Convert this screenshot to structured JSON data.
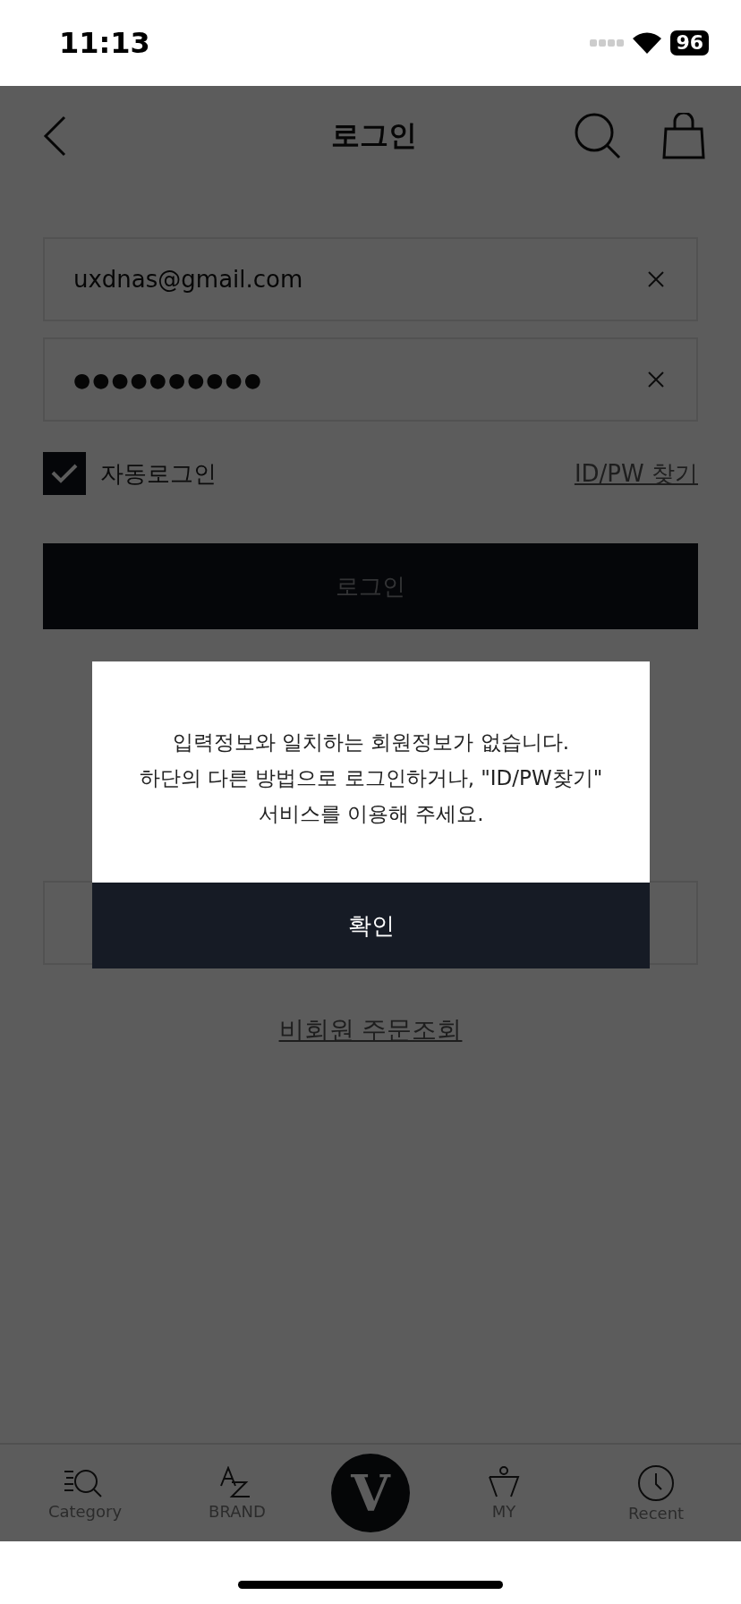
{
  "status_bar": {
    "time": "11:13",
    "battery": "96"
  },
  "header": {
    "title": "로그인"
  },
  "login_form": {
    "email": {
      "value": "uxdnas@gmail.com"
    },
    "password": {
      "value": "●●●●●●●●●●"
    },
    "auto_login": {
      "label": "자동로그인",
      "checked": true
    },
    "find_link": "ID/PW 찾기",
    "login_button": {
      "label": "로그인",
      "disabled": true
    }
  },
  "guest_order_link": "비회원 주문조회",
  "bottom_nav": [
    {
      "kind": "category",
      "label": "Category"
    },
    {
      "kind": "brand",
      "label": "BRAND"
    },
    {
      "kind": "home",
      "logo": "V"
    },
    {
      "kind": "my",
      "label": "MY"
    },
    {
      "kind": "recent",
      "label": "Recent"
    }
  ],
  "alert": {
    "message": "입력정보와 일치하는 회원정보가 없습니다.\n하단의 다른 방법으로 로그인하거나, \"ID/PW찾기\"\n서비스를 이용해 주세요.",
    "button": "확인"
  }
}
